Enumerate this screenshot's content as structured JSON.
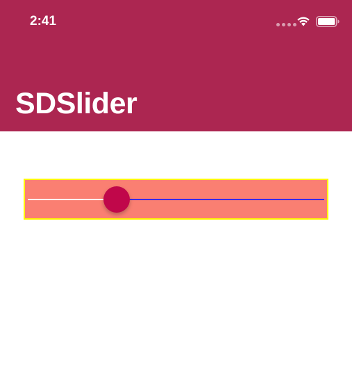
{
  "status_bar": {
    "time": "2:41",
    "icons": [
      "signal-dots-icon",
      "wifi-icon",
      "battery-icon"
    ]
  },
  "nav": {
    "title": "SDSlider"
  },
  "slider": {
    "value": 0.28,
    "min_track_color": "#FFFFFF",
    "max_track_color": "#3B28E6",
    "thumb_color": "#C0074A",
    "background_color": "#FA7F72",
    "border_color": "#FFF500"
  },
  "colors": {
    "header": "#AC2651",
    "background": "#FFFFFF"
  }
}
